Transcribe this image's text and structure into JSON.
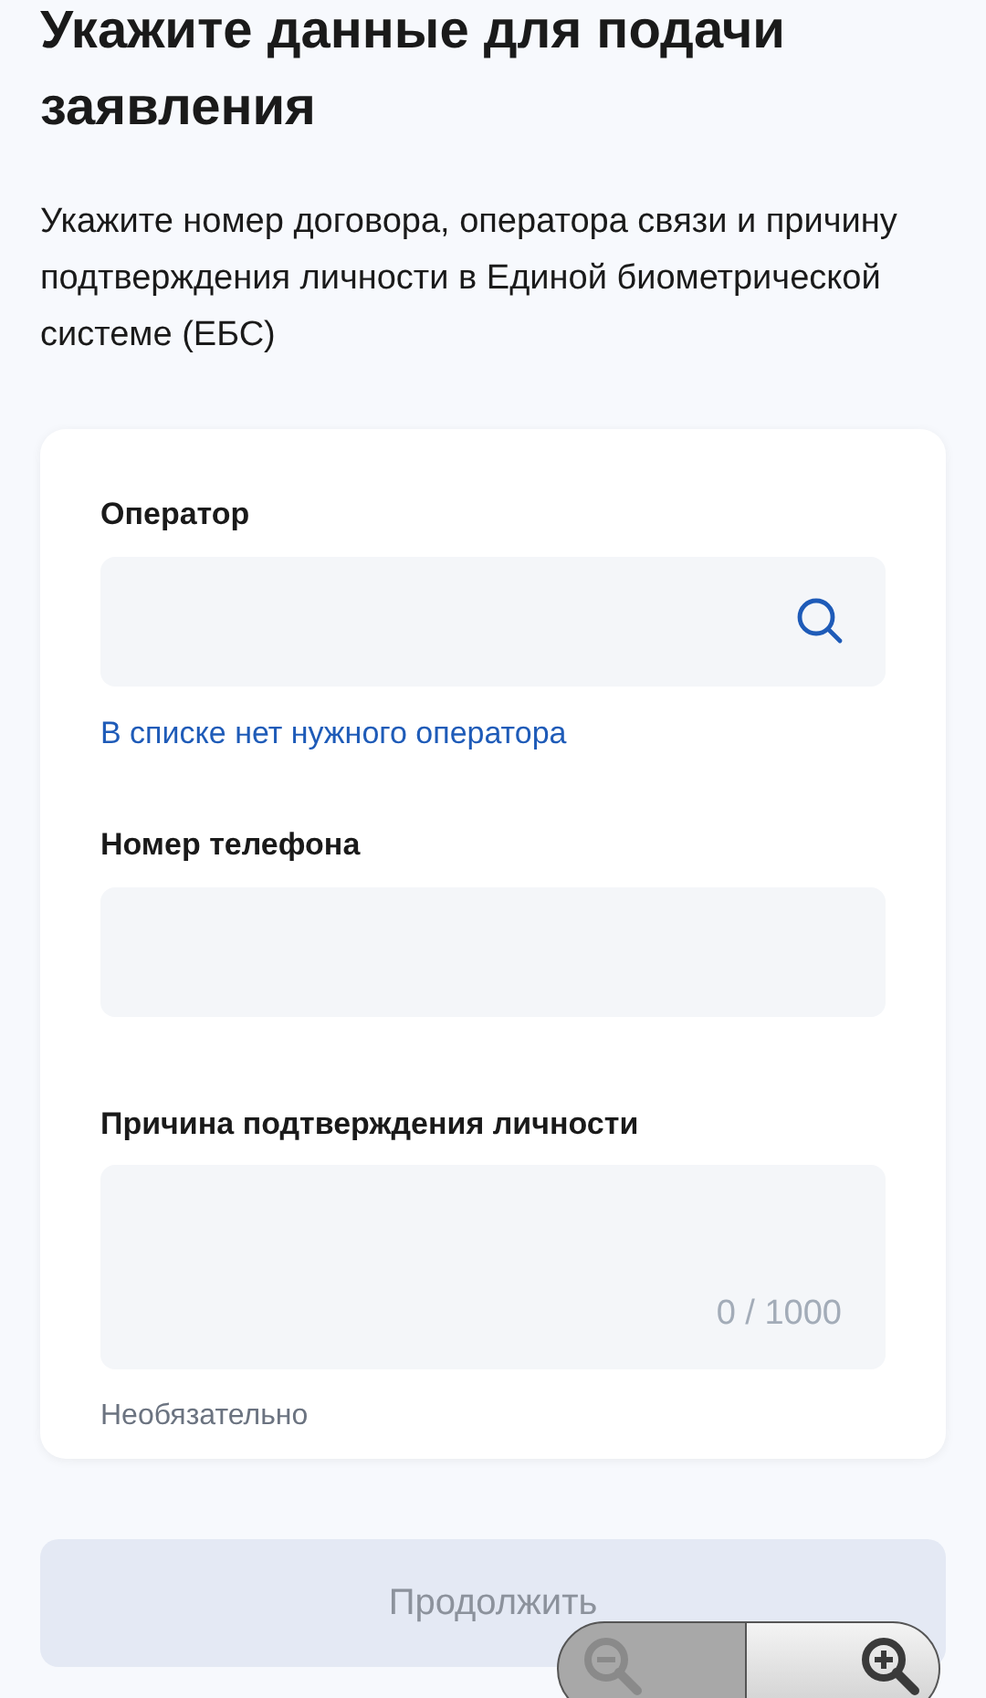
{
  "title": "Укажите данные для подачи заявления",
  "description": "Укажите номер договора, оператора связи и причину подтверждения личности в Единой биометрической системе (ЕБС)",
  "form": {
    "fields": [
      {
        "kind": "search",
        "label": "Оператор",
        "link": "В списке нет нужного оператора"
      },
      {
        "kind": "text",
        "label": "Номер телефона"
      },
      {
        "kind": "textarea",
        "label": "Причина подтверждения личности",
        "counter": "0 / 1000",
        "hint": "Необязательно"
      }
    ]
  },
  "submit": {
    "label": "Продолжить",
    "disabled": true
  },
  "zoom_controls": {
    "zoom_out_disabled": true,
    "zoom_in_disabled": false
  }
}
